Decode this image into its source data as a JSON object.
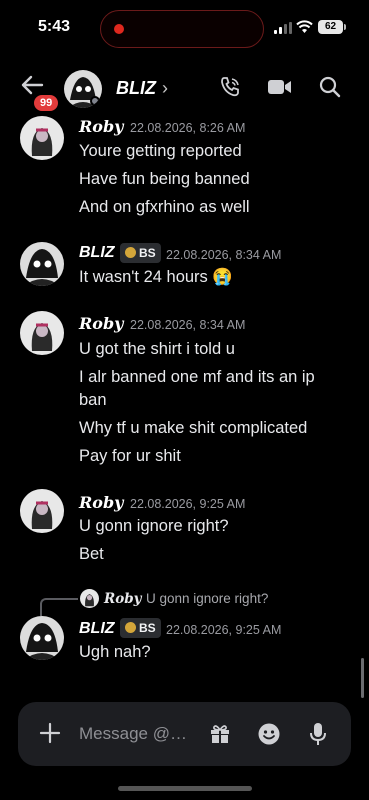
{
  "status_bar": {
    "time": "5:43",
    "battery": "62"
  },
  "header": {
    "notification_count": "99",
    "channel_name": "BLIZ",
    "chevron": "›"
  },
  "messages": [
    {
      "author": "Roby",
      "timestamp": "22.08.2026, 8:26 AM",
      "lines": [
        "Youre getting reported",
        "Have fun being banned",
        "And on gfxrhino as well"
      ]
    },
    {
      "author": "BLIZ",
      "tag": "BS",
      "timestamp": "22.08.2026, 8:34 AM",
      "lines": [
        "It wasn't 24 hours 😭"
      ]
    },
    {
      "author": "Roby",
      "timestamp": "22.08.2026, 8:34 AM",
      "lines": [
        "U got the shirt i told u",
        "I alr banned one mf and its an ip",
        "ban",
        "Why tf u make shit complicated",
        "Pay for ur shit"
      ]
    },
    {
      "author": "Roby",
      "timestamp": "22.08.2026, 9:25 AM",
      "lines": [
        "U gonn ignore right?",
        "Bet"
      ]
    },
    {
      "author": "BLIZ",
      "tag": "BS",
      "timestamp": "22.08.2026, 9:25 AM",
      "lines": [
        "Ugh nah?"
      ],
      "reply_to": {
        "author": "Roby",
        "text": "U gonn ignore right?"
      }
    }
  ],
  "composer": {
    "placeholder": "Message @…"
  },
  "icons": [
    "back-arrow-icon",
    "phone-call-icon",
    "video-camera-icon",
    "search-icon",
    "plus-icon",
    "gift-icon",
    "emoji-icon",
    "microphone-icon"
  ],
  "colors": {
    "background": "#000000",
    "badge": "#e23b3b",
    "composer": "#1d1e22",
    "timestamp": "#9a9ba1"
  }
}
